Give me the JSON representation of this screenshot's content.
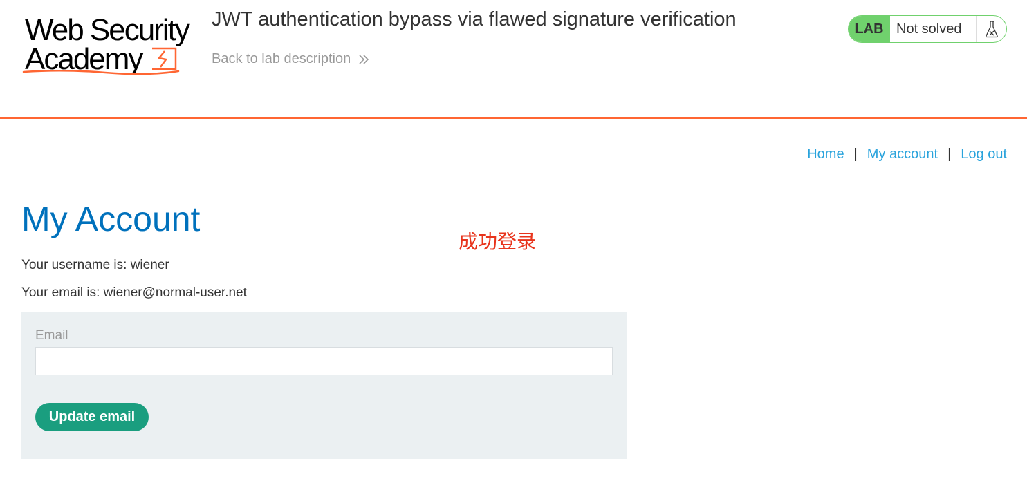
{
  "header": {
    "logo_line1": "Web Security",
    "logo_line2": "Academy",
    "logo_icon": "lightning-bolt-icon",
    "lab_title": "JWT authentication bypass via flawed signature verification",
    "back_link": "Back to lab description",
    "back_icon": "double-chevron-right-icon"
  },
  "lab_status": {
    "badge": "LAB",
    "status": "Not solved",
    "icon": "flask-icon",
    "badge_color": "#70d16d"
  },
  "nav": {
    "home": "Home",
    "my_account": "My account",
    "log_out": "Log out",
    "separator": "|"
  },
  "main": {
    "title": "My Account",
    "annotation": "成功登录",
    "username_line": "Your username is: wiener",
    "email_line": "Your email is: wiener@normal-user.net"
  },
  "form": {
    "email_label": "Email",
    "email_value": "",
    "submit_label": "Update email"
  },
  "colors": {
    "accent": "#ff6633",
    "title_blue": "#0071bc",
    "link_blue": "#29a3dc",
    "button_green": "#1a9e7f",
    "annotation_red": "#e8341c"
  }
}
